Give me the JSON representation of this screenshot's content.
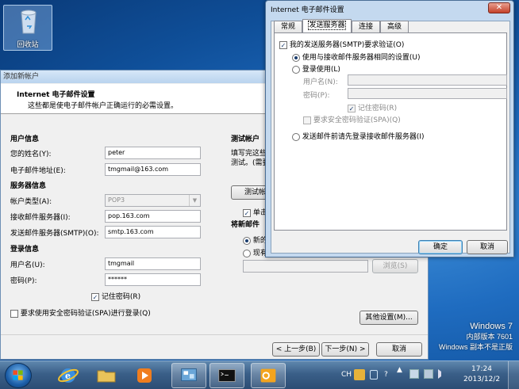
{
  "desktop": {
    "recycle_label": "回收站",
    "win7_line1": "Windows 7",
    "win7_line2": "内部版本 7601",
    "win7_line3": "Windows 副本不是正版"
  },
  "wizard": {
    "title": "添加新帐户",
    "header_title": "Internet 电子邮件设置",
    "header_subtitle": "这些都是使电子邮件帐户正确运行的必需设置。",
    "user_info": "用户信息",
    "name_label": "您的姓名(Y):",
    "name_value": "peter",
    "email_label": "电子邮件地址(E):",
    "email_value": "tmgmail@163.com",
    "server_info": "服务器信息",
    "account_type_label": "帐户类型(A):",
    "account_type_value": "POP3",
    "incoming_label": "接收邮件服务器(I):",
    "incoming_value": "pop.163.com",
    "outgoing_label": "发送邮件服务器(SMTP)(O):",
    "outgoing_value": "smtp.163.com",
    "logon_info": "登录信息",
    "username_label": "用户名(U):",
    "username_value": "tmgmail",
    "password_label": "密码(P):",
    "password_value": "******",
    "remember_label": "记住密码(R)",
    "spa_label": "要求使用安全密码验证(SPA)进行登录(Q)",
    "test_title": "测试帐户",
    "test_desc1": "填写完这些",
    "test_desc2": "测试。(需要",
    "test_button": "测试帐户",
    "test_check_label": "单击",
    "deliver_title": "将新邮件",
    "radio_new": "新的",
    "radio_existing": "现有",
    "browse_button": "浏览(S)",
    "more_settings_button": "其他设置(M)...",
    "back_button": "< 上一步(B)",
    "next_button": "下一步(N) >",
    "cancel_button": "取消"
  },
  "dialog": {
    "title": "Internet 电子邮件设置",
    "close_glyph": "✕",
    "tabs": [
      "常规",
      "发送服务器",
      "连接",
      "高级"
    ],
    "smtp_auth_label": "我的发送服务器(SMTP)要求验证(O)",
    "same_settings_label": "使用与接收邮件服务器相同的设置(U)",
    "logon_using_label": "登录使用(L)",
    "username_label": "用户名(N):",
    "password_label": "密码(P):",
    "remember_label": "记住密码(R)",
    "spa_label": "要求安全密码验证(SPA)(Q)",
    "logon_before_label": "发送邮件前请先登录接收邮件服务器(I)",
    "ok_button": "确定",
    "cancel_button": "取消"
  },
  "taskbar": {
    "lang": "CH",
    "time": "17:24",
    "date": "2013/12/2"
  }
}
